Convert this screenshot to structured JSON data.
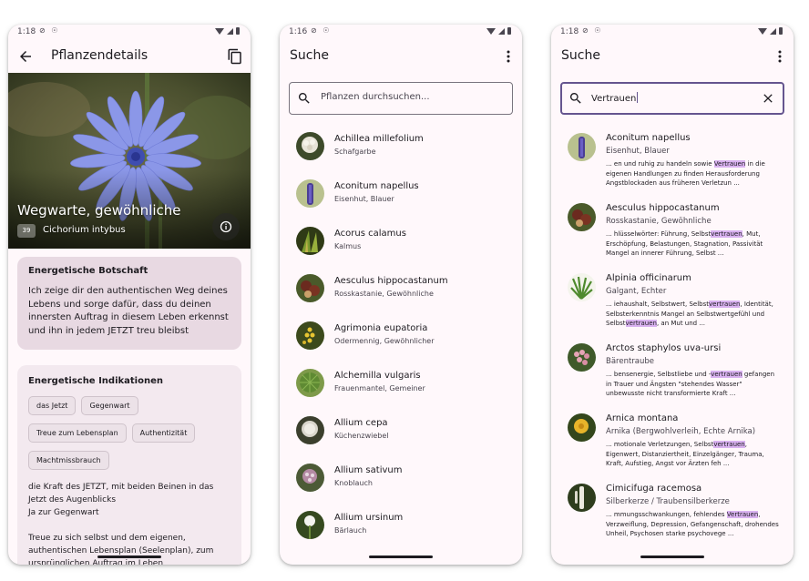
{
  "status": {
    "time": "1:18",
    "time2": "1:16",
    "time3": "1:18"
  },
  "detail": {
    "title": "Pflanzendetails",
    "plant_name": "Wegwarte, gewöhnliche",
    "plant_number": "39",
    "plant_latin": "Cichorium intybus",
    "message_title": "Energetische Botschaft",
    "message_text": "Ich zeige dir den authentischen Weg deines Lebens und sorge dafür, dass du deinen innersten Auftrag in diesem Leben erkennst und ihn in jedem JETZT treu bleibst",
    "indications_title": "Energetische Indikationen",
    "chips": [
      "das Jetzt",
      "Gegenwart",
      "Treue zum Lebensplan",
      "Authentizität",
      "Machtmissbrauch"
    ],
    "body1": "die Kraft des JETZT, mit beiden Beinen in das Jetzt des Augenblicks",
    "body2": "Ja zur Gegenwart",
    "body3": "Treue zu sich selbst und dem eigenen, authentischen Lebensplan (Seelenplan), zum ursprünglichen Auftrag im Leben"
  },
  "search": {
    "title": "Suche",
    "placeholder": "Pflanzen durchsuchen...",
    "items": [
      {
        "latin": "Achillea millefolium",
        "common": "Schafgarbe"
      },
      {
        "latin": "Aconitum napellus",
        "common": "Eisenhut, Blauer"
      },
      {
        "latin": "Acorus calamus",
        "common": "Kalmus"
      },
      {
        "latin": "Aesculus hippocastanum",
        "common": "Rosskastanie, Gewöhnliche"
      },
      {
        "latin": "Agrimonia eupatoria",
        "common": "Odermennig, Gewöhnlicher"
      },
      {
        "latin": "Alchemilla vulgaris",
        "common": "Frauenmantel, Gemeiner"
      },
      {
        "latin": "Allium cepa",
        "common": "Küchenzwiebel"
      },
      {
        "latin": "Allium sativum",
        "common": "Knoblauch"
      },
      {
        "latin": "Allium ursinum",
        "common": "Bärlauch"
      }
    ]
  },
  "results": {
    "title": "Suche",
    "query": "Vertrauen",
    "items": [
      {
        "latin": "Aconitum napellus",
        "common": "Eisenhut, Blauer",
        "s1": "... en und ruhig zu handeln sowie ",
        "h1": "Vertrauen",
        "s2": " in die eigenen Handlungen zu finden Herausforderung Angstblockaden aus früheren Verletzun ...",
        "h2": "",
        "s3": ""
      },
      {
        "latin": "Aesculus hippocastanum",
        "common": "Rosskastanie, Gewöhnliche",
        "s1": "... hlüsselwörter: Führung, Selbst",
        "h1": "vertrauen",
        "s2": ", Mut, Erschöpfung, Belastungen, Stagnation, Passivität Mangel an innerer Führung, Selbst ...",
        "h2": "",
        "s3": ""
      },
      {
        "latin": "Alpinia officinarum",
        "common": "Galgant, Echter",
        "s1": "... iehaushalt, Selbstwert, Selbst",
        "h1": "vertrauen",
        "s2": ", Identität, Selbsterkenntnis Mangel an Selbstwertgefühl und Selbst",
        "h2": "vertrauen",
        "s3": ", an Mut und ..."
      },
      {
        "latin": "Arctos staphylos uva-ursi",
        "common": "Bärentraube",
        "s1": "... bensenergie, Selbstliebe und -",
        "h1": "vertrauen",
        "s2": " gefangen in Trauer und Ängsten \"stehendes Wasser\" unbewusste nicht transformierte Kraft ...",
        "h2": "",
        "s3": ""
      },
      {
        "latin": "Arnica montana",
        "common": "Arnika (Bergwohlverleih, Echte Arnika)",
        "s1": "... motionale Verletzungen, Selbst",
        "h1": "vertrauen",
        "s2": ", Eigenwert, Distanziertheit, Einzelgänger, Trauma, Kraft, Aufstieg, Angst vor Ärzten feh ...",
        "h2": "",
        "s3": ""
      },
      {
        "latin": "Cimicifuga racemosa",
        "common": "Silberkerze / Traubensilberkerze",
        "s1": "... mmungsschwankungen, fehlendes ",
        "h1": "Vertrauen",
        "s2": ", Verzweiflung, Depression, Gefangenschaft, drohendes Unheil, Psychosen starke psychovege ...",
        "h2": "",
        "s3": ""
      }
    ]
  },
  "colors": {
    "accent": "#65558f",
    "background": "#fff8fb",
    "card": "#e8d9e2",
    "highlight": "#d9b2f0"
  }
}
